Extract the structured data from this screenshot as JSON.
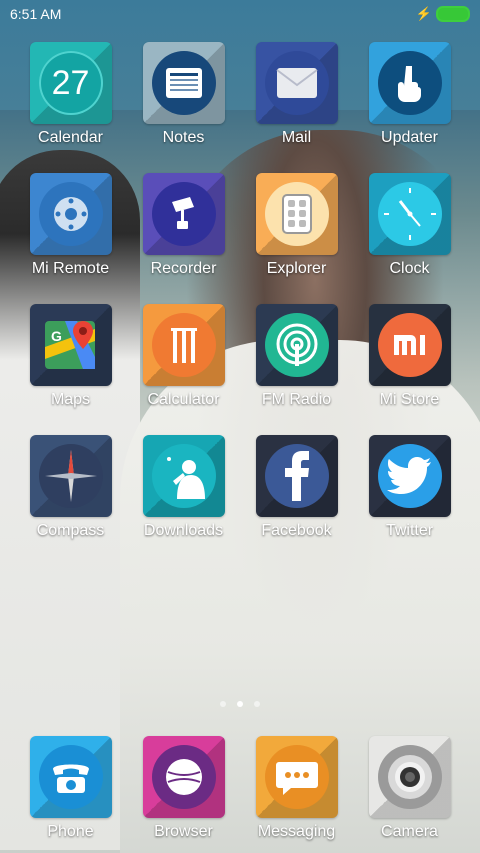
{
  "status_bar": {
    "time": "6:51 AM",
    "charging_icon": "bolt-icon",
    "battery_color": "#37c837"
  },
  "apps": [
    {
      "name": "calendar",
      "label": "Calendar",
      "icon": "calendar-icon",
      "text": "27",
      "bg": "#23b7b4",
      "circle": "#13a4a3"
    },
    {
      "name": "notes",
      "label": "Notes",
      "icon": "notes-icon",
      "bg": "#9ab6c3",
      "circle": "#17487a"
    },
    {
      "name": "mail",
      "label": "Mail",
      "icon": "envelope-icon",
      "bg": "#3753a3",
      "circle": "#2f4a99"
    },
    {
      "name": "updater",
      "label": "Updater",
      "icon": "hand-icon",
      "bg": "#32a2dd",
      "circle": "#0d4e7e"
    },
    {
      "name": "mi-remote",
      "label": "Mi Remote",
      "icon": "remote-icon",
      "bg": "#3d86d0",
      "circle": "#2d74bd"
    },
    {
      "name": "recorder",
      "label": "Recorder",
      "icon": "microphone-icon",
      "bg": "#5a4eb9",
      "circle": "#30309a"
    },
    {
      "name": "explorer",
      "label": "Explorer",
      "icon": "folder-grid-icon",
      "bg": "#f9ad56",
      "circle": "#fce2ad"
    },
    {
      "name": "clock",
      "label": "Clock",
      "icon": "clock-icon",
      "bg": "#1d9fc0",
      "circle": "#2cc9e6"
    },
    {
      "name": "maps",
      "label": "Maps",
      "icon": "map-pin-icon",
      "bg": "#2b3a56",
      "circle": "#3c9e5b"
    },
    {
      "name": "calculator",
      "label": "Calculator",
      "icon": "cricket-stumps-icon",
      "bg": "#f59a3e",
      "circle": "#f07a32"
    },
    {
      "name": "fm-radio",
      "label": "FM Radio",
      "icon": "radio-signal-icon",
      "bg": "#2c3a52",
      "circle": "#21b793"
    },
    {
      "name": "mi-store",
      "label": "Mi Store",
      "icon": "mi-logo-icon",
      "bg": "#273140",
      "circle": "#ef6a3d"
    },
    {
      "name": "compass",
      "label": "Compass",
      "icon": "compass-icon",
      "bg": "#3a5277",
      "circle": "#2f3f60"
    },
    {
      "name": "downloads",
      "label": "Downloads",
      "icon": "cricketer-icon",
      "bg": "#16a6b3",
      "circle": "#1ab5c1"
    },
    {
      "name": "facebook",
      "label": "Facebook",
      "icon": "facebook-icon",
      "bg": "#2a3142",
      "circle": "#3b5997"
    },
    {
      "name": "twitter",
      "label": "Twitter",
      "icon": "twitter-bird-icon",
      "bg": "#2a3142",
      "circle": "#2a9fe8"
    }
  ],
  "page_indicator": {
    "pages": 3,
    "active": 2
  },
  "dock": [
    {
      "name": "phone",
      "label": "Phone",
      "icon": "phone-icon",
      "bg": "#2fb0ea",
      "circle": "#1a8fd5"
    },
    {
      "name": "browser",
      "label": "Browser",
      "icon": "cricket-ball-icon",
      "bg": "#d83d9b",
      "circle": "#6b2b84"
    },
    {
      "name": "messaging",
      "label": "Messaging",
      "icon": "chat-bubble-icon",
      "bg": "#f2a93b",
      "circle": "#e98f24"
    },
    {
      "name": "camera",
      "label": "Camera",
      "icon": "camera-lens-icon",
      "bg": "#e7e7e5",
      "circle": "#9a9a9a"
    }
  ]
}
